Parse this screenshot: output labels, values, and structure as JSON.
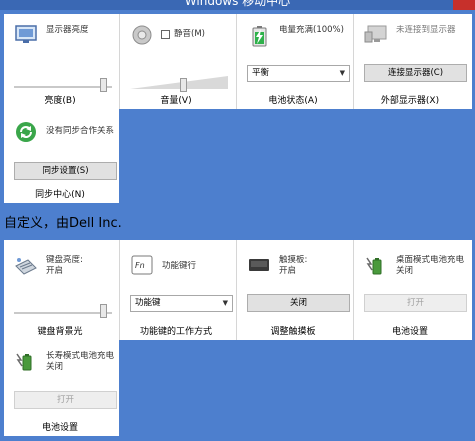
{
  "window": {
    "title": "Windows 移动中心"
  },
  "section_main": {
    "tiles": [
      {
        "name": "brightness",
        "icon": "display-brightness-icon",
        "text": [
          "显示器亮度"
        ],
        "slider_level": 0.95,
        "label": "亮度(B)"
      },
      {
        "name": "volume",
        "icon": "speaker-icon",
        "mute_label": "静音(M)",
        "mute_checked": false,
        "slider_level": 0.55,
        "label": "音量(V)"
      },
      {
        "name": "battery",
        "icon": "battery-charging-icon",
        "text": [
          "电量充满(100%)"
        ],
        "select_value": "平衡",
        "label": "电池状态(A)"
      },
      {
        "name": "external-display",
        "icon": "external-monitor-icon",
        "text": [
          "未连接到显示器"
        ],
        "button": "连接显示器(C)",
        "label": "外部显示器(X)"
      },
      {
        "name": "sync-center",
        "icon": "sync-icon",
        "text": [
          "没有同步合作关系"
        ],
        "button": "同步设置(S)",
        "label": "同步中心(N)"
      }
    ]
  },
  "vendor_heading": "自定义，由Dell Inc.",
  "section_vendor": {
    "tiles": [
      {
        "name": "keyboard-backlight",
        "icon": "keyboard-backlight-icon",
        "text": [
          "键盘亮度:",
          "开启"
        ],
        "slider_level": 0.95,
        "label": "键盘背景光"
      },
      {
        "name": "function-keys",
        "icon": "fn-key-icon",
        "text": [
          "功能键行"
        ],
        "select_value": "功能键",
        "label": "功能键的工作方式"
      },
      {
        "name": "touchpad",
        "icon": "touchpad-icon",
        "text": [
          "触摸板:",
          "开启"
        ],
        "button": "关闭",
        "label": "调整触摸板"
      },
      {
        "name": "battery-desktop-mode",
        "icon": "battery-plug-icon",
        "text": [
          "桌面模式电池充电",
          "关闭"
        ],
        "button": "打开",
        "button_disabled": true,
        "label": "电池设置"
      },
      {
        "name": "battery-longevity",
        "icon": "battery-plug-icon",
        "text": [
          "长寿模式电池充电",
          "关闭"
        ],
        "button": "打开",
        "button_disabled": true,
        "label": "电池设置"
      }
    ]
  }
}
